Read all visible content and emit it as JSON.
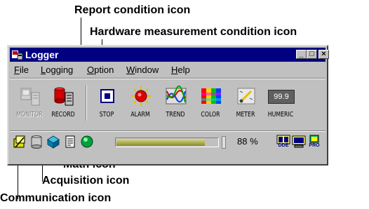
{
  "callouts": {
    "report_condition": "Report condition icon",
    "hardware_measurement_condition": "Hardware measurement condition icon",
    "math": "Math icon",
    "acquisition": "Acquisition icon",
    "communication": "Communication icon"
  },
  "window": {
    "title": "Logger",
    "controls": [
      "_",
      "□",
      "×"
    ]
  },
  "menu": [
    {
      "label": "File",
      "underline": "F",
      "rest": "ile"
    },
    {
      "label": "Logging",
      "underline": "L",
      "rest": "ogging"
    },
    {
      "label": "Option",
      "underline": "O",
      "rest": "ption"
    },
    {
      "label": "Window",
      "underline": "W",
      "rest": "indow"
    },
    {
      "label": "Help",
      "underline": "H",
      "rest": "elp"
    }
  ],
  "toolbar": {
    "monitor": {
      "label": "MONITOR",
      "enabled": false,
      "icon": "monitor-icon"
    },
    "record": {
      "label": "RECORD",
      "enabled": true,
      "icon": "record-icon"
    },
    "stop": {
      "label": "STOP",
      "enabled": true,
      "icon": "stop-icon"
    },
    "alarm": {
      "label": "ALARM",
      "enabled": true,
      "icon": "alarm-icon"
    },
    "trend": {
      "label": "TREND",
      "enabled": true,
      "icon": "trend-icon"
    },
    "color": {
      "label": "COLOR",
      "enabled": true,
      "icon": "color-icon"
    },
    "meter": {
      "label": "METER",
      "enabled": true,
      "icon": "meter-icon"
    },
    "numeric": {
      "label": "HUMERIC",
      "value": "99.9",
      "enabled": true,
      "icon": "numeric-icon"
    }
  },
  "status": {
    "progress_percent": 88,
    "progress_text": "88 %",
    "indicators": [
      "communication-icon",
      "acquisition-icon",
      "math-icon",
      "report-condition-icon",
      "hardware-measurement-condition-icon"
    ],
    "right_icons": [
      "DDE",
      "dde-icon",
      "PRO"
    ]
  },
  "colors": {
    "titlebar": "#000080",
    "face": "#c0c0c0",
    "progress": "#9a9a35",
    "hardware_ok": "#00a040"
  }
}
